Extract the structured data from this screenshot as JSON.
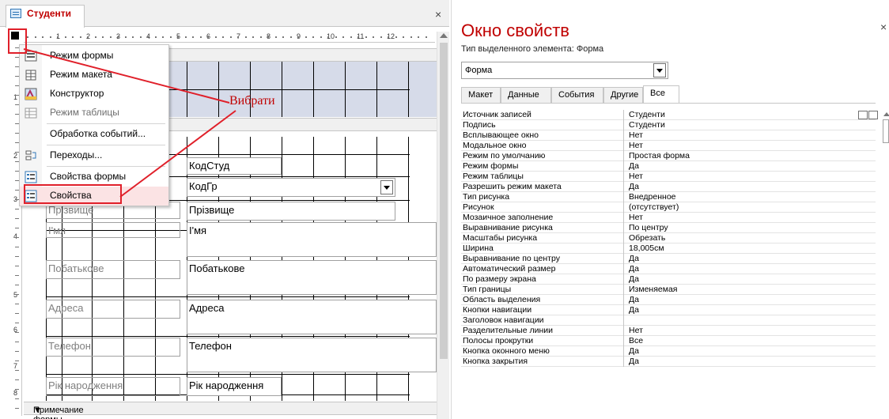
{
  "doc": {
    "tab_title": "Студенти",
    "close_glyph": "×",
    "ruler_numbers": [
      "1",
      "2",
      "3",
      "4",
      "5",
      "6",
      "7",
      "8",
      "9",
      "10",
      "11",
      "12"
    ],
    "vruler_numbers": [
      "1",
      "2",
      "3",
      "4",
      "5",
      "6",
      "7",
      "8"
    ],
    "footer_band": "Примечание формы",
    "fields": {
      "kodstud": "КодСтуд",
      "kodgr": "КодГр",
      "pr_label": "Прізвище",
      "pr_value": "Прізвище",
      "im_label": "І'мя",
      "im_value": "І'мя",
      "pb_label": "Побатькове",
      "pb_value": "Побатькове",
      "adr_label": "Адреса",
      "adr_value": "Адреса",
      "tel_label": "Телефон",
      "tel_value": "Телефон",
      "rn_label": "Рік народження",
      "rn_value": "Рік народження"
    }
  },
  "menu": {
    "items": [
      {
        "label": "Режим формы",
        "icon": "form-view-icon",
        "disabled": false
      },
      {
        "label": "Режим макета",
        "icon": "layout-view-icon",
        "disabled": false
      },
      {
        "label": "Конструктор",
        "icon": "design-view-icon",
        "disabled": false
      },
      {
        "label": "Режим таблицы",
        "icon": "datasheet-view-icon",
        "disabled": true
      },
      {
        "label": "Обработка событий...",
        "icon": "",
        "disabled": false
      },
      {
        "label": "Переходы...",
        "icon": "tab-order-icon",
        "disabled": false
      },
      {
        "label": "Свойства формы",
        "icon": "form-properties-icon",
        "disabled": false
      },
      {
        "label": "Свойства",
        "icon": "properties-icon",
        "disabled": false
      }
    ]
  },
  "annotation": {
    "text": "Вибрати",
    "color": "#e0202a"
  },
  "props": {
    "title": "Окно свойств",
    "close_glyph": "×",
    "selection_type_label": "Тип выделенного элемента: Форма",
    "selected_object": "Форма",
    "tabs": [
      "Макет",
      "Данные",
      "События",
      "Другие",
      "Все"
    ],
    "active_tab": "Все",
    "rows": [
      {
        "name": "Источник записей",
        "value": "Студенти"
      },
      {
        "name": "Подпись",
        "value": "Студенти"
      },
      {
        "name": "Всплывающее окно",
        "value": "Нет"
      },
      {
        "name": "Модальное окно",
        "value": "Нет"
      },
      {
        "name": "Режим по умолчанию",
        "value": "Простая форма"
      },
      {
        "name": "Режим формы",
        "value": "Да"
      },
      {
        "name": "Режим таблицы",
        "value": "Нет"
      },
      {
        "name": "Разрешить режим макета",
        "value": "Да"
      },
      {
        "name": "Тип рисунка",
        "value": "Внедренное"
      },
      {
        "name": "Рисунок",
        "value": "(отсутствует)"
      },
      {
        "name": "Мозаичное заполнение",
        "value": "Нет"
      },
      {
        "name": "Выравнивание рисунка",
        "value": "По центру"
      },
      {
        "name": "Масштабы рисунка",
        "value": "Обрезать"
      },
      {
        "name": "Ширина",
        "value": "18,005см"
      },
      {
        "name": "Выравнивание по центру",
        "value": "Да"
      },
      {
        "name": "Автоматический размер",
        "value": "Да"
      },
      {
        "name": "По размеру экрана",
        "value": "Да"
      },
      {
        "name": "Тип границы",
        "value": "Изменяемая"
      },
      {
        "name": "Область выделения",
        "value": "Да"
      },
      {
        "name": "Кнопки навигации",
        "value": "Да"
      },
      {
        "name": "Заголовок навигации",
        "value": ""
      },
      {
        "name": "Разделительные линии",
        "value": "Нет"
      },
      {
        "name": "Полосы прокрутки",
        "value": "Все"
      },
      {
        "name": "Кнопка оконного меню",
        "value": "Да"
      },
      {
        "name": "Кнопка закрытия",
        "value": "Да"
      }
    ]
  }
}
